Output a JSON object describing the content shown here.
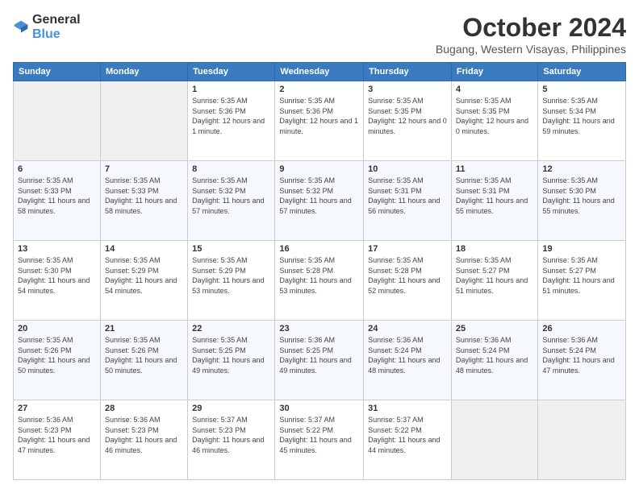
{
  "logo": {
    "general": "General",
    "blue": "Blue"
  },
  "title": "October 2024",
  "location": "Bugang, Western Visayas, Philippines",
  "weekdays": [
    "Sunday",
    "Monday",
    "Tuesday",
    "Wednesday",
    "Thursday",
    "Friday",
    "Saturday"
  ],
  "weeks": [
    [
      {
        "day": "",
        "sunrise": "",
        "sunset": "",
        "daylight": ""
      },
      {
        "day": "",
        "sunrise": "",
        "sunset": "",
        "daylight": ""
      },
      {
        "day": "1",
        "sunrise": "Sunrise: 5:35 AM",
        "sunset": "Sunset: 5:36 PM",
        "daylight": "Daylight: 12 hours and 1 minute."
      },
      {
        "day": "2",
        "sunrise": "Sunrise: 5:35 AM",
        "sunset": "Sunset: 5:36 PM",
        "daylight": "Daylight: 12 hours and 1 minute."
      },
      {
        "day": "3",
        "sunrise": "Sunrise: 5:35 AM",
        "sunset": "Sunset: 5:35 PM",
        "daylight": "Daylight: 12 hours and 0 minutes."
      },
      {
        "day": "4",
        "sunrise": "Sunrise: 5:35 AM",
        "sunset": "Sunset: 5:35 PM",
        "daylight": "Daylight: 12 hours and 0 minutes."
      },
      {
        "day": "5",
        "sunrise": "Sunrise: 5:35 AM",
        "sunset": "Sunset: 5:34 PM",
        "daylight": "Daylight: 11 hours and 59 minutes."
      }
    ],
    [
      {
        "day": "6",
        "sunrise": "Sunrise: 5:35 AM",
        "sunset": "Sunset: 5:33 PM",
        "daylight": "Daylight: 11 hours and 58 minutes."
      },
      {
        "day": "7",
        "sunrise": "Sunrise: 5:35 AM",
        "sunset": "Sunset: 5:33 PM",
        "daylight": "Daylight: 11 hours and 58 minutes."
      },
      {
        "day": "8",
        "sunrise": "Sunrise: 5:35 AM",
        "sunset": "Sunset: 5:32 PM",
        "daylight": "Daylight: 11 hours and 57 minutes."
      },
      {
        "day": "9",
        "sunrise": "Sunrise: 5:35 AM",
        "sunset": "Sunset: 5:32 PM",
        "daylight": "Daylight: 11 hours and 57 minutes."
      },
      {
        "day": "10",
        "sunrise": "Sunrise: 5:35 AM",
        "sunset": "Sunset: 5:31 PM",
        "daylight": "Daylight: 11 hours and 56 minutes."
      },
      {
        "day": "11",
        "sunrise": "Sunrise: 5:35 AM",
        "sunset": "Sunset: 5:31 PM",
        "daylight": "Daylight: 11 hours and 55 minutes."
      },
      {
        "day": "12",
        "sunrise": "Sunrise: 5:35 AM",
        "sunset": "Sunset: 5:30 PM",
        "daylight": "Daylight: 11 hours and 55 minutes."
      }
    ],
    [
      {
        "day": "13",
        "sunrise": "Sunrise: 5:35 AM",
        "sunset": "Sunset: 5:30 PM",
        "daylight": "Daylight: 11 hours and 54 minutes."
      },
      {
        "day": "14",
        "sunrise": "Sunrise: 5:35 AM",
        "sunset": "Sunset: 5:29 PM",
        "daylight": "Daylight: 11 hours and 54 minutes."
      },
      {
        "day": "15",
        "sunrise": "Sunrise: 5:35 AM",
        "sunset": "Sunset: 5:29 PM",
        "daylight": "Daylight: 11 hours and 53 minutes."
      },
      {
        "day": "16",
        "sunrise": "Sunrise: 5:35 AM",
        "sunset": "Sunset: 5:28 PM",
        "daylight": "Daylight: 11 hours and 53 minutes."
      },
      {
        "day": "17",
        "sunrise": "Sunrise: 5:35 AM",
        "sunset": "Sunset: 5:28 PM",
        "daylight": "Daylight: 11 hours and 52 minutes."
      },
      {
        "day": "18",
        "sunrise": "Sunrise: 5:35 AM",
        "sunset": "Sunset: 5:27 PM",
        "daylight": "Daylight: 11 hours and 51 minutes."
      },
      {
        "day": "19",
        "sunrise": "Sunrise: 5:35 AM",
        "sunset": "Sunset: 5:27 PM",
        "daylight": "Daylight: 11 hours and 51 minutes."
      }
    ],
    [
      {
        "day": "20",
        "sunrise": "Sunrise: 5:35 AM",
        "sunset": "Sunset: 5:26 PM",
        "daylight": "Daylight: 11 hours and 50 minutes."
      },
      {
        "day": "21",
        "sunrise": "Sunrise: 5:35 AM",
        "sunset": "Sunset: 5:26 PM",
        "daylight": "Daylight: 11 hours and 50 minutes."
      },
      {
        "day": "22",
        "sunrise": "Sunrise: 5:35 AM",
        "sunset": "Sunset: 5:25 PM",
        "daylight": "Daylight: 11 hours and 49 minutes."
      },
      {
        "day": "23",
        "sunrise": "Sunrise: 5:36 AM",
        "sunset": "Sunset: 5:25 PM",
        "daylight": "Daylight: 11 hours and 49 minutes."
      },
      {
        "day": "24",
        "sunrise": "Sunrise: 5:36 AM",
        "sunset": "Sunset: 5:24 PM",
        "daylight": "Daylight: 11 hours and 48 minutes."
      },
      {
        "day": "25",
        "sunrise": "Sunrise: 5:36 AM",
        "sunset": "Sunset: 5:24 PM",
        "daylight": "Daylight: 11 hours and 48 minutes."
      },
      {
        "day": "26",
        "sunrise": "Sunrise: 5:36 AM",
        "sunset": "Sunset: 5:24 PM",
        "daylight": "Daylight: 11 hours and 47 minutes."
      }
    ],
    [
      {
        "day": "27",
        "sunrise": "Sunrise: 5:36 AM",
        "sunset": "Sunset: 5:23 PM",
        "daylight": "Daylight: 11 hours and 47 minutes."
      },
      {
        "day": "28",
        "sunrise": "Sunrise: 5:36 AM",
        "sunset": "Sunset: 5:23 PM",
        "daylight": "Daylight: 11 hours and 46 minutes."
      },
      {
        "day": "29",
        "sunrise": "Sunrise: 5:37 AM",
        "sunset": "Sunset: 5:23 PM",
        "daylight": "Daylight: 11 hours and 46 minutes."
      },
      {
        "day": "30",
        "sunrise": "Sunrise: 5:37 AM",
        "sunset": "Sunset: 5:22 PM",
        "daylight": "Daylight: 11 hours and 45 minutes."
      },
      {
        "day": "31",
        "sunrise": "Sunrise: 5:37 AM",
        "sunset": "Sunset: 5:22 PM",
        "daylight": "Daylight: 11 hours and 44 minutes."
      },
      {
        "day": "",
        "sunrise": "",
        "sunset": "",
        "daylight": ""
      },
      {
        "day": "",
        "sunrise": "",
        "sunset": "",
        "daylight": ""
      }
    ]
  ]
}
